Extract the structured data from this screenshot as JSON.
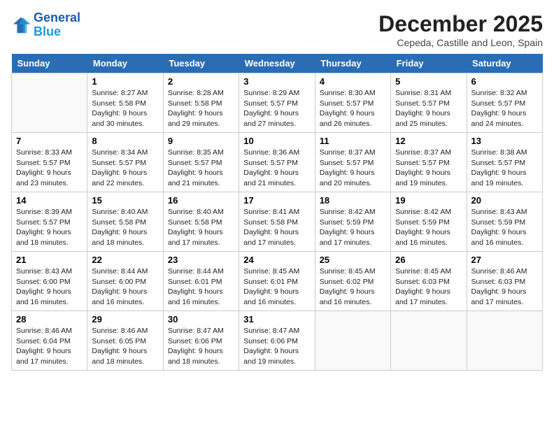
{
  "logo": {
    "line1": "General",
    "line2": "Blue"
  },
  "title": "December 2025",
  "subtitle": "Cepeda, Castille and Leon, Spain",
  "days_of_week": [
    "Sunday",
    "Monday",
    "Tuesday",
    "Wednesday",
    "Thursday",
    "Friday",
    "Saturday"
  ],
  "weeks": [
    [
      {
        "day": "",
        "info": ""
      },
      {
        "day": "1",
        "info": "Sunrise: 8:27 AM\nSunset: 5:58 PM\nDaylight: 9 hours\nand 30 minutes."
      },
      {
        "day": "2",
        "info": "Sunrise: 8:28 AM\nSunset: 5:58 PM\nDaylight: 9 hours\nand 29 minutes."
      },
      {
        "day": "3",
        "info": "Sunrise: 8:29 AM\nSunset: 5:57 PM\nDaylight: 9 hours\nand 27 minutes."
      },
      {
        "day": "4",
        "info": "Sunrise: 8:30 AM\nSunset: 5:57 PM\nDaylight: 9 hours\nand 26 minutes."
      },
      {
        "day": "5",
        "info": "Sunrise: 8:31 AM\nSunset: 5:57 PM\nDaylight: 9 hours\nand 25 minutes."
      },
      {
        "day": "6",
        "info": "Sunrise: 8:32 AM\nSunset: 5:57 PM\nDaylight: 9 hours\nand 24 minutes."
      }
    ],
    [
      {
        "day": "7",
        "info": "Sunrise: 8:33 AM\nSunset: 5:57 PM\nDaylight: 9 hours\nand 23 minutes."
      },
      {
        "day": "8",
        "info": "Sunrise: 8:34 AM\nSunset: 5:57 PM\nDaylight: 9 hours\nand 22 minutes."
      },
      {
        "day": "9",
        "info": "Sunrise: 8:35 AM\nSunset: 5:57 PM\nDaylight: 9 hours\nand 21 minutes."
      },
      {
        "day": "10",
        "info": "Sunrise: 8:36 AM\nSunset: 5:57 PM\nDaylight: 9 hours\nand 21 minutes."
      },
      {
        "day": "11",
        "info": "Sunrise: 8:37 AM\nSunset: 5:57 PM\nDaylight: 9 hours\nand 20 minutes."
      },
      {
        "day": "12",
        "info": "Sunrise: 8:37 AM\nSunset: 5:57 PM\nDaylight: 9 hours\nand 19 minutes."
      },
      {
        "day": "13",
        "info": "Sunrise: 8:38 AM\nSunset: 5:57 PM\nDaylight: 9 hours\nand 19 minutes."
      }
    ],
    [
      {
        "day": "14",
        "info": "Sunrise: 8:39 AM\nSunset: 5:57 PM\nDaylight: 9 hours\nand 18 minutes."
      },
      {
        "day": "15",
        "info": "Sunrise: 8:40 AM\nSunset: 5:58 PM\nDaylight: 9 hours\nand 18 minutes."
      },
      {
        "day": "16",
        "info": "Sunrise: 8:40 AM\nSunset: 5:58 PM\nDaylight: 9 hours\nand 17 minutes."
      },
      {
        "day": "17",
        "info": "Sunrise: 8:41 AM\nSunset: 5:58 PM\nDaylight: 9 hours\nand 17 minutes."
      },
      {
        "day": "18",
        "info": "Sunrise: 8:42 AM\nSunset: 5:59 PM\nDaylight: 9 hours\nand 17 minutes."
      },
      {
        "day": "19",
        "info": "Sunrise: 8:42 AM\nSunset: 5:59 PM\nDaylight: 9 hours\nand 16 minutes."
      },
      {
        "day": "20",
        "info": "Sunrise: 8:43 AM\nSunset: 5:59 PM\nDaylight: 9 hours\nand 16 minutes."
      }
    ],
    [
      {
        "day": "21",
        "info": "Sunrise: 8:43 AM\nSunset: 6:00 PM\nDaylight: 9 hours\nand 16 minutes."
      },
      {
        "day": "22",
        "info": "Sunrise: 8:44 AM\nSunset: 6:00 PM\nDaylight: 9 hours\nand 16 minutes."
      },
      {
        "day": "23",
        "info": "Sunrise: 8:44 AM\nSunset: 6:01 PM\nDaylight: 9 hours\nand 16 minutes."
      },
      {
        "day": "24",
        "info": "Sunrise: 8:45 AM\nSunset: 6:01 PM\nDaylight: 9 hours\nand 16 minutes."
      },
      {
        "day": "25",
        "info": "Sunrise: 8:45 AM\nSunset: 6:02 PM\nDaylight: 9 hours\nand 16 minutes."
      },
      {
        "day": "26",
        "info": "Sunrise: 8:45 AM\nSunset: 6:03 PM\nDaylight: 9 hours\nand 17 minutes."
      },
      {
        "day": "27",
        "info": "Sunrise: 8:46 AM\nSunset: 6:03 PM\nDaylight: 9 hours\nand 17 minutes."
      }
    ],
    [
      {
        "day": "28",
        "info": "Sunrise: 8:46 AM\nSunset: 6:04 PM\nDaylight: 9 hours\nand 17 minutes."
      },
      {
        "day": "29",
        "info": "Sunrise: 8:46 AM\nSunset: 6:05 PM\nDaylight: 9 hours\nand 18 minutes."
      },
      {
        "day": "30",
        "info": "Sunrise: 8:47 AM\nSunset: 6:06 PM\nDaylight: 9 hours\nand 18 minutes."
      },
      {
        "day": "31",
        "info": "Sunrise: 8:47 AM\nSunset: 6:06 PM\nDaylight: 9 hours\nand 19 minutes."
      },
      {
        "day": "",
        "info": ""
      },
      {
        "day": "",
        "info": ""
      },
      {
        "day": "",
        "info": ""
      }
    ]
  ]
}
